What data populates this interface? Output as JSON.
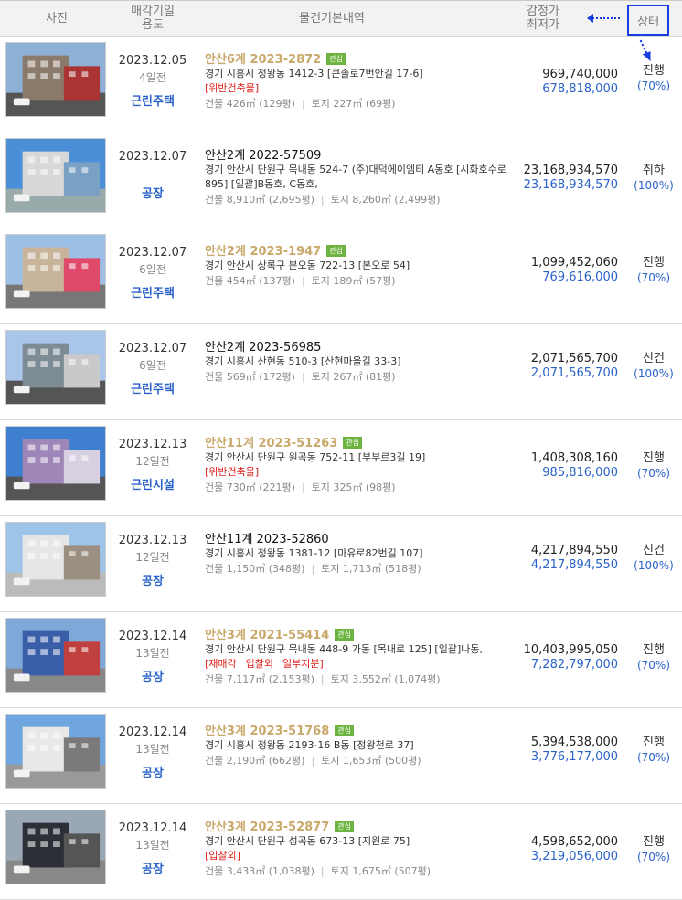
{
  "header": {
    "photo": "사진",
    "date_line1": "매각기일",
    "date_line2": "용도",
    "desc": "물건기본내역",
    "price_line1": "감정가",
    "price_line2": "최저가",
    "status": "상태"
  },
  "rows": [
    {
      "date": "2023.12.05",
      "ago": "4일전",
      "use": "근린주택",
      "case": "안산6계 2023-2872",
      "interest": true,
      "badge": "관심",
      "addr": [
        "경기 시흥시 정왕동 1412-3 [큰솔로7번안길 17-6]"
      ],
      "warn": [
        "[위반건축물]"
      ],
      "bldg": "건물 426㎡ (129평)",
      "land": "토지 227㎡ (69평)",
      "appraisal": "969,740,000",
      "min": "678,818,000",
      "status": "진행",
      "pct": "(70%)"
    },
    {
      "date": "2023.12.07",
      "ago": "",
      "use": "공장",
      "case": "안산2계 2022-57509",
      "interest": false,
      "badge": "",
      "addr": [
        "경기 안산시 단원구 목내동 524-7 (주)대덕에이엠티 A동호 [시화호수로",
        "895] [일괄]B동호, C동호,"
      ],
      "warn": [],
      "bldg": "건물 8,910㎡ (2,695평)",
      "land": "토지 8,260㎡ (2,499평)",
      "appraisal": "23,168,934,570",
      "min": "23,168,934,570",
      "status": "취하",
      "pct": "(100%)"
    },
    {
      "date": "2023.12.07",
      "ago": "6일전",
      "use": "근린주택",
      "case": "안산2계 2023-1947",
      "interest": true,
      "badge": "관심",
      "addr": [
        "경기 안산시 상록구 본오동 722-13 [본오로 54]"
      ],
      "warn": [],
      "bldg": "건물 454㎡ (137평)",
      "land": "토지 189㎡ (57평)",
      "appraisal": "1,099,452,060",
      "min": "769,616,000",
      "status": "진행",
      "pct": "(70%)"
    },
    {
      "date": "2023.12.07",
      "ago": "6일전",
      "use": "근린주택",
      "case": "안산2계 2023-56985",
      "interest": false,
      "badge": "",
      "addr": [
        "경기 시흥시 산현동 510-3 [산현마을길 33-3]"
      ],
      "warn": [],
      "bldg": "건물 569㎡ (172평)",
      "land": "토지 267㎡ (81평)",
      "appraisal": "2,071,565,700",
      "min": "2,071,565,700",
      "status": "신건",
      "pct": "(100%)"
    },
    {
      "date": "2023.12.13",
      "ago": "12일전",
      "use": "근린시설",
      "case": "안산11계 2023-51263",
      "interest": true,
      "badge": "관심",
      "addr": [
        "경기 안산시 단원구 원곡동 752-11 [부부르3길 19]"
      ],
      "warn": [
        "[위반건축물]"
      ],
      "bldg": "건물 730㎡ (221평)",
      "land": "토지 325㎡ (98평)",
      "appraisal": "1,408,308,160",
      "min": "985,816,000",
      "status": "진행",
      "pct": "(70%)"
    },
    {
      "date": "2023.12.13",
      "ago": "12일전",
      "use": "공장",
      "case": "안산11계 2023-52860",
      "interest": false,
      "badge": "",
      "addr": [
        "경기 시흥시 정왕동 1381-12 [마유로82번길 107]"
      ],
      "warn": [],
      "bldg": "건물 1,150㎡ (348평)",
      "land": "토지 1,713㎡ (518평)",
      "appraisal": "4,217,894,550",
      "min": "4,217,894,550",
      "status": "신건",
      "pct": "(100%)"
    },
    {
      "date": "2023.12.14",
      "ago": "13일전",
      "use": "공장",
      "case": "안산3계 2021-55414",
      "interest": true,
      "badge": "관심",
      "addr": [
        "경기 안산시 단원구 목내동 448-9 가동 [목내로 125] [일괄]나동,"
      ],
      "warn": [
        "[재매각",
        "입찰외",
        "일부지분]"
      ],
      "bldg": "건물 7,117㎡ (2,153평)",
      "land": "토지 3,552㎡ (1,074평)",
      "appraisal": "10,403,995,050",
      "min": "7,282,797,000",
      "status": "진행",
      "pct": "(70%)"
    },
    {
      "date": "2023.12.14",
      "ago": "13일전",
      "use": "공장",
      "case": "안산3계 2023-51768",
      "interest": true,
      "badge": "관심",
      "addr": [
        "경기 시흥시 정왕동 2193-16 B동 [정왕천로 37]"
      ],
      "warn": [],
      "bldg": "건물 2,190㎡ (662평)",
      "land": "토지 1,653㎡ (500평)",
      "appraisal": "5,394,538,000",
      "min": "3,776,177,000",
      "status": "진행",
      "pct": "(70%)"
    },
    {
      "date": "2023.12.14",
      "ago": "13일전",
      "use": "공장",
      "case": "안산3계 2023-52877",
      "interest": true,
      "badge": "관심",
      "addr": [
        "경기 안산시 단원구 성곡동 673-13 [지원로 75]"
      ],
      "warn": [
        "[입찰외]"
      ],
      "bldg": "건물 3,433㎡ (1,038평)",
      "land": "토지 1,675㎡ (507평)",
      "appraisal": "4,598,652,000",
      "min": "3,219,056,000",
      "status": "진행",
      "pct": "(70%)"
    }
  ]
}
